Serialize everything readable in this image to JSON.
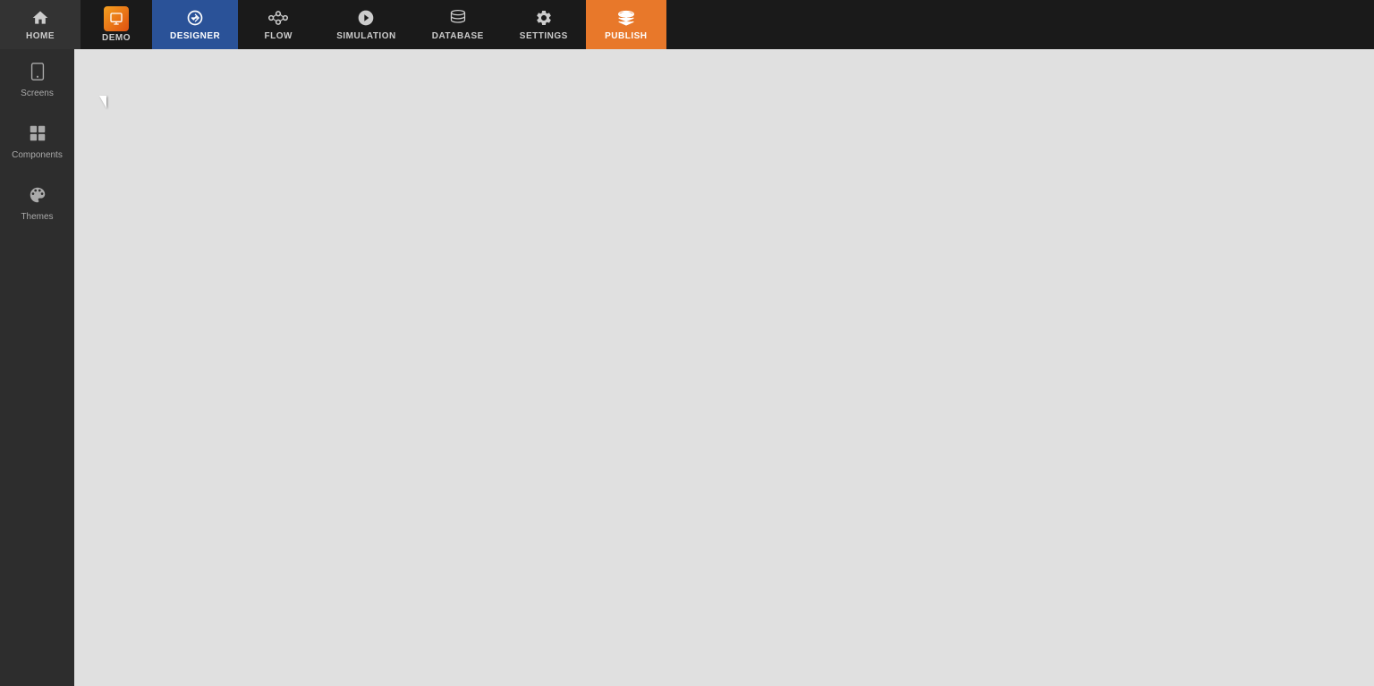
{
  "nav": {
    "items": [
      {
        "id": "home",
        "label": "HOME",
        "icon": "home",
        "active": false
      },
      {
        "id": "demo",
        "label": "Demo",
        "icon": "demo",
        "active": false
      },
      {
        "id": "designer",
        "label": "DESIGNER",
        "icon": "designer",
        "active": true
      },
      {
        "id": "flow",
        "label": "FLOW",
        "icon": "flow",
        "active": false
      },
      {
        "id": "simulation",
        "label": "SIMULATION",
        "icon": "simulation",
        "active": false
      },
      {
        "id": "database",
        "label": "DATABASE",
        "icon": "database",
        "active": false
      },
      {
        "id": "settings",
        "label": "SETTINGS",
        "icon": "settings",
        "active": false
      },
      {
        "id": "publish",
        "label": "PUBLISH",
        "icon": "publish",
        "active": false
      }
    ]
  },
  "sidebar": {
    "items": [
      {
        "id": "screens",
        "label": "Screens",
        "icon": "phone"
      },
      {
        "id": "components",
        "label": "Components",
        "icon": "grid"
      },
      {
        "id": "themes",
        "label": "Themes",
        "icon": "palette"
      }
    ]
  },
  "colors": {
    "nav_bg": "#1a1a1a",
    "active_nav": "#2a5298",
    "publish_bg": "#e8782a",
    "sidebar_bg": "#2d2d2d",
    "canvas_bg": "#e0e0e0"
  }
}
